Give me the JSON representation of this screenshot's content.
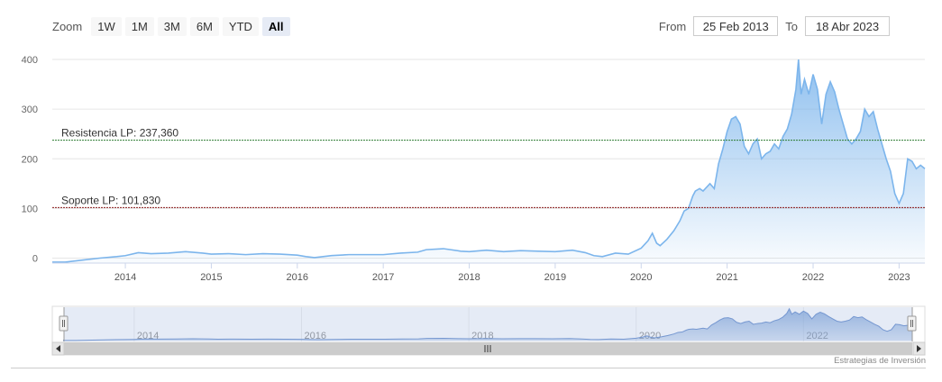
{
  "zoom": {
    "label": "Zoom",
    "buttons": [
      "1W",
      "1M",
      "3M",
      "6M",
      "YTD",
      "All"
    ],
    "active": "All"
  },
  "range": {
    "from_label": "From",
    "from_value": "25 Feb 2013",
    "to_label": "To",
    "to_value": "18 Abr 2023"
  },
  "credit": "Estrategias de Inversión",
  "colors": {
    "series": "#7cb5ec",
    "resistance": "#2e7d32",
    "support": "#8b1a1a",
    "navigator_mask": "#c5d2ea"
  },
  "chart_data": {
    "type": "area",
    "title": "",
    "xlabel": "",
    "ylabel": "",
    "x_ticks": [
      "2014",
      "2015",
      "2016",
      "2017",
      "2018",
      "2019",
      "2020",
      "2021",
      "2022",
      "2023"
    ],
    "y_ticks": [
      0,
      100,
      200,
      300,
      400
    ],
    "ylim": [
      -10,
      420
    ],
    "xlim": [
      2013.15,
      2023.3
    ],
    "grid": true,
    "series": [
      {
        "values": [
          [
            2013.15,
            -8
          ],
          [
            2013.3,
            -8
          ],
          [
            2013.5,
            -4
          ],
          [
            2013.7,
            0
          ],
          [
            2013.9,
            3
          ],
          [
            2014.0,
            5
          ],
          [
            2014.15,
            11
          ],
          [
            2014.3,
            9
          ],
          [
            2014.5,
            10
          ],
          [
            2014.7,
            13
          ],
          [
            2014.9,
            10
          ],
          [
            2015.0,
            8
          ],
          [
            2015.2,
            9
          ],
          [
            2015.4,
            7
          ],
          [
            2015.6,
            9
          ],
          [
            2015.8,
            8
          ],
          [
            2016.0,
            6
          ],
          [
            2016.1,
            3
          ],
          [
            2016.2,
            1
          ],
          [
            2016.4,
            5
          ],
          [
            2016.6,
            7
          ],
          [
            2016.8,
            7
          ],
          [
            2017.0,
            7
          ],
          [
            2017.2,
            10
          ],
          [
            2017.4,
            12
          ],
          [
            2017.5,
            17
          ],
          [
            2017.7,
            19
          ],
          [
            2017.9,
            14
          ],
          [
            2018.0,
            13
          ],
          [
            2018.2,
            16
          ],
          [
            2018.4,
            13
          ],
          [
            2018.6,
            15
          ],
          [
            2018.8,
            14
          ],
          [
            2019.0,
            13
          ],
          [
            2019.2,
            16
          ],
          [
            2019.35,
            11
          ],
          [
            2019.45,
            5
          ],
          [
            2019.55,
            3
          ],
          [
            2019.7,
            10
          ],
          [
            2019.85,
            8
          ],
          [
            2020.0,
            20
          ],
          [
            2020.08,
            35
          ],
          [
            2020.13,
            50
          ],
          [
            2020.18,
            30
          ],
          [
            2020.22,
            25
          ],
          [
            2020.3,
            38
          ],
          [
            2020.38,
            55
          ],
          [
            2020.45,
            75
          ],
          [
            2020.5,
            95
          ],
          [
            2020.55,
            100
          ],
          [
            2020.6,
            125
          ],
          [
            2020.63,
            135
          ],
          [
            2020.68,
            140
          ],
          [
            2020.72,
            135
          ],
          [
            2020.8,
            150
          ],
          [
            2020.85,
            140
          ],
          [
            2020.9,
            190
          ],
          [
            2020.95,
            220
          ],
          [
            2021.0,
            255
          ],
          [
            2021.05,
            280
          ],
          [
            2021.1,
            285
          ],
          [
            2021.15,
            270
          ],
          [
            2021.2,
            225
          ],
          [
            2021.25,
            210
          ],
          [
            2021.3,
            230
          ],
          [
            2021.35,
            240
          ],
          [
            2021.4,
            200
          ],
          [
            2021.45,
            210
          ],
          [
            2021.5,
            215
          ],
          [
            2021.55,
            230
          ],
          [
            2021.6,
            220
          ],
          [
            2021.65,
            245
          ],
          [
            2021.7,
            260
          ],
          [
            2021.75,
            290
          ],
          [
            2021.8,
            340
          ],
          [
            2021.83,
            400
          ],
          [
            2021.86,
            330
          ],
          [
            2021.9,
            360
          ],
          [
            2021.95,
            330
          ],
          [
            2022.0,
            370
          ],
          [
            2022.05,
            340
          ],
          [
            2022.1,
            270
          ],
          [
            2022.15,
            330
          ],
          [
            2022.2,
            355
          ],
          [
            2022.25,
            335
          ],
          [
            2022.3,
            300
          ],
          [
            2022.35,
            270
          ],
          [
            2022.4,
            240
          ],
          [
            2022.45,
            230
          ],
          [
            2022.5,
            240
          ],
          [
            2022.55,
            255
          ],
          [
            2022.6,
            300
          ],
          [
            2022.65,
            285
          ],
          [
            2022.7,
            295
          ],
          [
            2022.75,
            260
          ],
          [
            2022.8,
            230
          ],
          [
            2022.85,
            200
          ],
          [
            2022.9,
            175
          ],
          [
            2022.95,
            130
          ],
          [
            2023.0,
            110
          ],
          [
            2023.05,
            130
          ],
          [
            2023.1,
            200
          ],
          [
            2023.15,
            195
          ],
          [
            2023.2,
            180
          ],
          [
            2023.25,
            187
          ],
          [
            2023.3,
            180
          ]
        ]
      }
    ],
    "annotations": [
      {
        "label": "Resistencia LP: 237,360",
        "y": 237.36
      },
      {
        "label": "Soporte LP: 101,830",
        "y": 101.83
      }
    ],
    "navigator": {
      "x_ticks": [
        "2014",
        "2016",
        "2018",
        "2020",
        "2022"
      ]
    }
  }
}
